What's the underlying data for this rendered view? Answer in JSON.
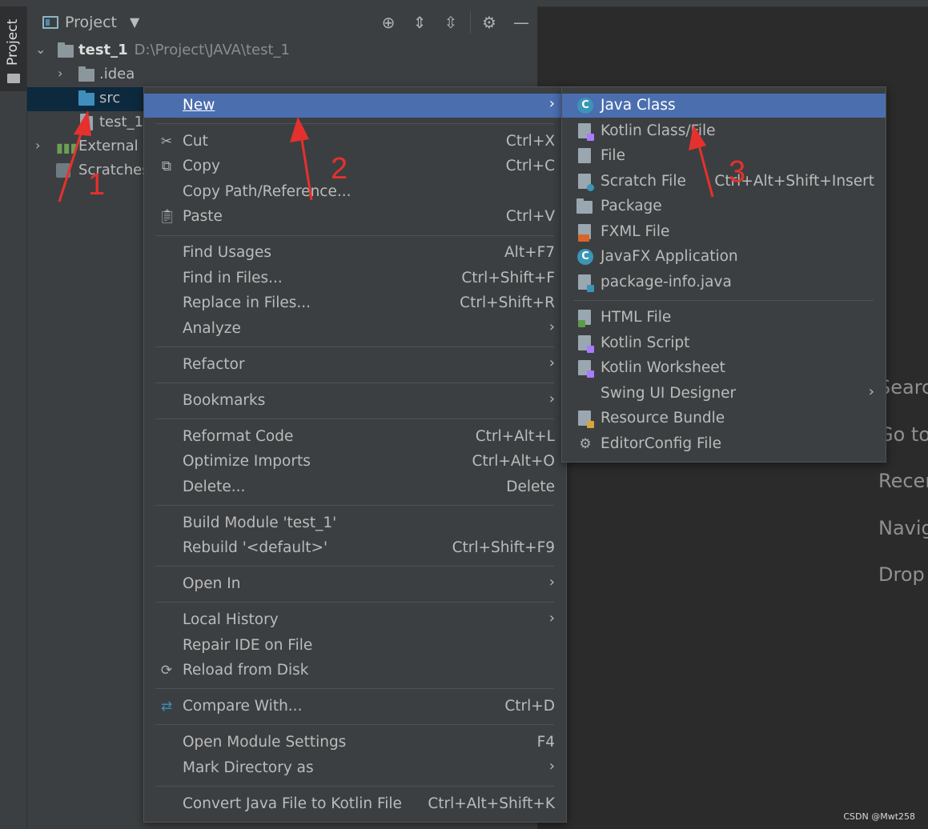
{
  "project_panel": {
    "stripe_label": "Project",
    "title": "Project",
    "tree": {
      "root_name": "test_1",
      "root_path": "D:\\Project\\JAVA\\test_1",
      "idea": ".idea",
      "src": "src",
      "iml": "test_1.",
      "external": "External L",
      "scratches": "Scratches"
    }
  },
  "context_menu": {
    "new": "New",
    "cut": {
      "label": "Cut",
      "shortcut": "Ctrl+X"
    },
    "copy": {
      "label": "Copy",
      "shortcut": "Ctrl+C"
    },
    "copy_path": "Copy Path/Reference...",
    "paste": {
      "label": "Paste",
      "shortcut": "Ctrl+V"
    },
    "find_usages": {
      "label": "Find Usages",
      "shortcut": "Alt+F7"
    },
    "find_in_files": {
      "label": "Find in Files...",
      "shortcut": "Ctrl+Shift+F"
    },
    "replace_in_files": {
      "label": "Replace in Files...",
      "shortcut": "Ctrl+Shift+R"
    },
    "analyze": "Analyze",
    "refactor": "Refactor",
    "bookmarks": "Bookmarks",
    "reformat": {
      "label": "Reformat Code",
      "shortcut": "Ctrl+Alt+L"
    },
    "optimize": {
      "label": "Optimize Imports",
      "shortcut": "Ctrl+Alt+O"
    },
    "delete": {
      "label": "Delete...",
      "shortcut": "Delete"
    },
    "build_module": "Build Module 'test_1'",
    "rebuild": {
      "label": "Rebuild '<default>'",
      "shortcut": "Ctrl+Shift+F9"
    },
    "open_in": "Open In",
    "local_history": "Local History",
    "repair_ide": "Repair IDE on File",
    "reload": "Reload from Disk",
    "compare": {
      "label": "Compare With...",
      "shortcut": "Ctrl+D"
    },
    "module_settings": {
      "label": "Open Module Settings",
      "shortcut": "F4"
    },
    "mark_directory": "Mark Directory as",
    "convert": {
      "label": "Convert Java File to Kotlin File",
      "shortcut": "Ctrl+Alt+Shift+K"
    }
  },
  "new_submenu": {
    "java_class": "Java Class",
    "kotlin_class": "Kotlin Class/File",
    "file": "File",
    "scratch": {
      "label": "Scratch File",
      "shortcut": "Ctrl+Alt+Shift+Insert"
    },
    "package": "Package",
    "fxml": "FXML File",
    "javafx": "JavaFX Application",
    "package_info": "package-info.java",
    "html": "HTML File",
    "kotlin_script": "Kotlin Script",
    "kotlin_worksheet": "Kotlin Worksheet",
    "swing": "Swing UI Designer",
    "resource_bundle": "Resource Bundle",
    "editorconfig": "EditorConfig File"
  },
  "editor_hints": [
    "Searc",
    "Go to",
    "Recen",
    "Navig",
    "Drop"
  ],
  "annotations": [
    "1",
    "2",
    "3"
  ],
  "watermark": "CSDN @Mwt258",
  "colors": {
    "highlight": "#4b6eaf",
    "selection": "#0d293e",
    "arrow": "#e5312e"
  }
}
